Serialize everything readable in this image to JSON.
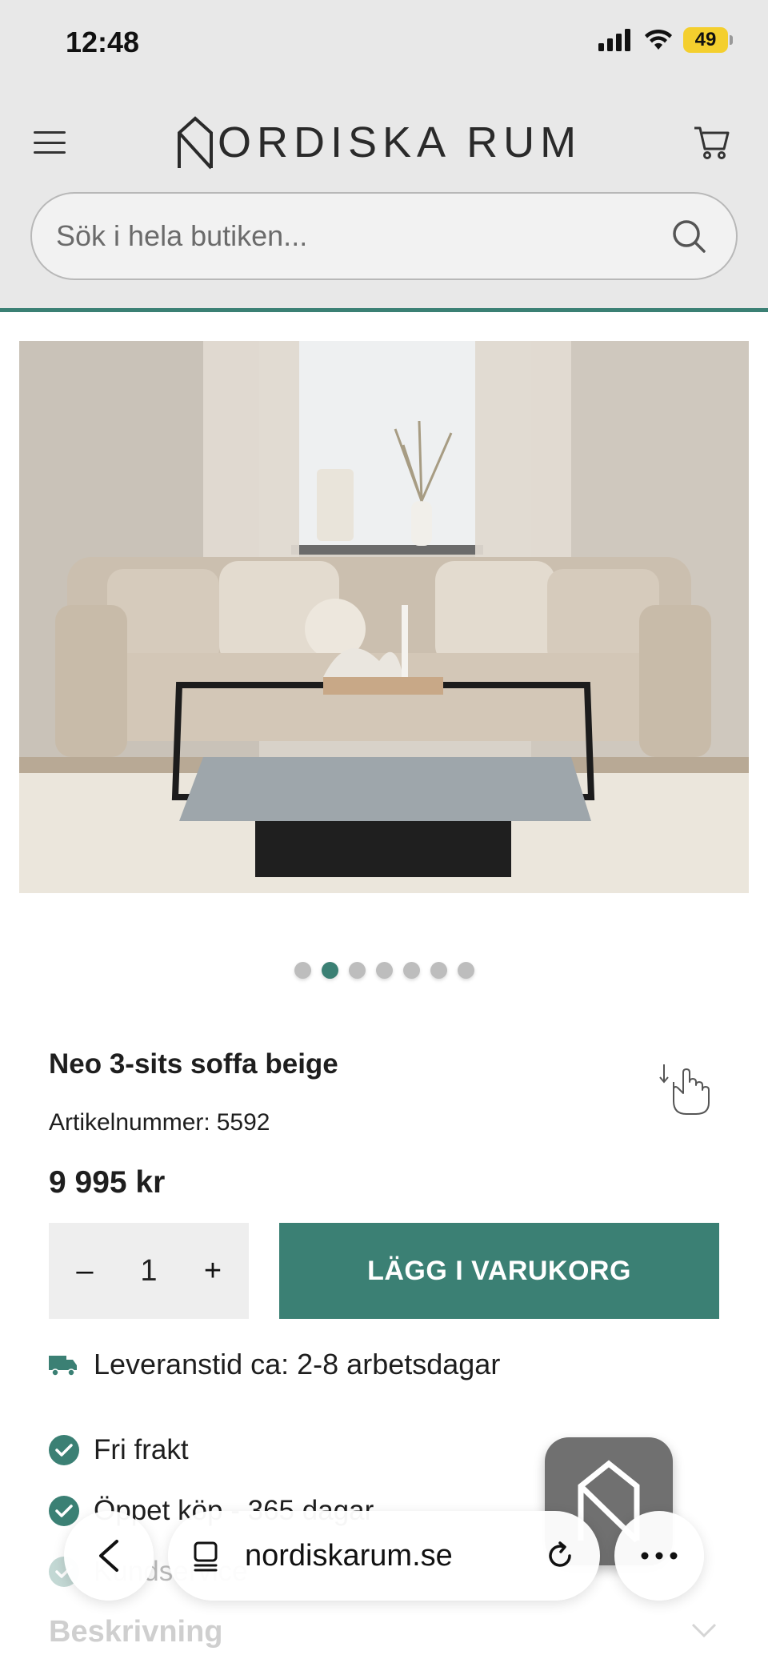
{
  "status_bar": {
    "time": "12:48",
    "battery": "49",
    "battery_color": "#f4cf2e"
  },
  "header": {
    "logo_text": "ORDISKA RUM",
    "logo_text_full": "NORDISKA RUM",
    "menu_icon": "hamburger-menu-icon",
    "cart_icon": "cart-icon"
  },
  "search": {
    "placeholder": "Sök i hela butiken...",
    "icon": "search-icon"
  },
  "product": {
    "image_description": "beige-sofa-with-glass-coffee-table",
    "carousel": {
      "count": 7,
      "active_index": 1
    },
    "title": "Neo 3-sits soffa beige",
    "article_label": "Artikelnummer:",
    "article_number": "5592",
    "price": "9 995 kr",
    "quantity": {
      "minus": "–",
      "value": "1",
      "plus": "+"
    },
    "add_to_cart": "LÄGG I VARUKORG",
    "delivery": "Leveranstid ca: 2-8 arbetsdagar",
    "usps": [
      "Fri frakt",
      "Öppet köp - 365 dagar",
      "Kundservice"
    ],
    "description_heading": "Beskrivning"
  },
  "browser": {
    "url": "nordiskarum.se",
    "back_icon": "back-icon",
    "tabs_icon": "tabs-icon",
    "reload_icon": "reload-icon",
    "more_icon": "more-icon"
  },
  "colors": {
    "accent": "#3b8074",
    "header_bg": "#e8e8e8"
  }
}
